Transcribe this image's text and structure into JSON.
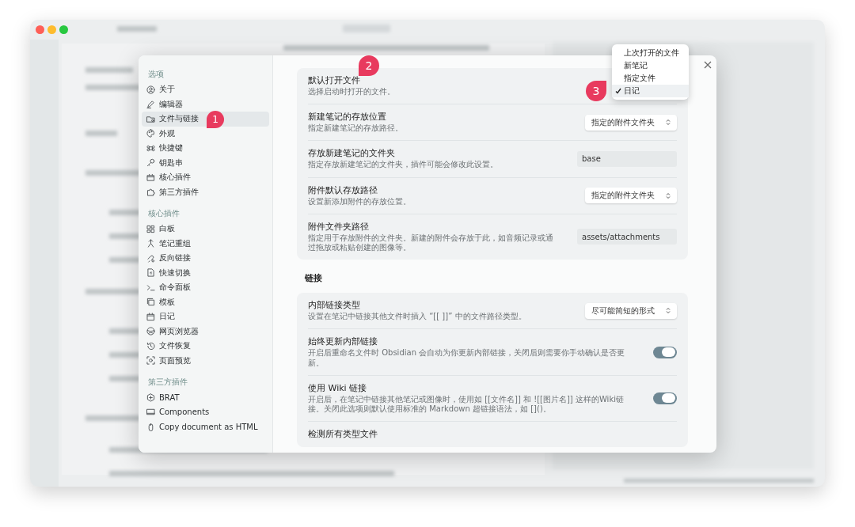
{
  "sidebar": {
    "sections": [
      {
        "heading": "选项",
        "items": [
          {
            "label": "关于",
            "selected": false
          },
          {
            "label": "编辑器",
            "selected": false
          },
          {
            "label": "文件与链接",
            "selected": true,
            "marker": "1"
          },
          {
            "label": "外观",
            "selected": false
          },
          {
            "label": "快捷键",
            "selected": false
          },
          {
            "label": "钥匙串",
            "selected": false
          },
          {
            "label": "核心插件",
            "selected": false
          },
          {
            "label": "第三方插件",
            "selected": false
          }
        ]
      },
      {
        "heading": "核心插件",
        "items": [
          {
            "label": "白板",
            "selected": false
          },
          {
            "label": "笔记重组",
            "selected": false
          },
          {
            "label": "反向链接",
            "selected": false
          },
          {
            "label": "快速切换",
            "selected": false
          },
          {
            "label": "命令面板",
            "selected": false
          },
          {
            "label": "模板",
            "selected": false
          },
          {
            "label": "日记",
            "selected": false
          },
          {
            "label": "网页浏览器",
            "selected": false
          },
          {
            "label": "文件恢复",
            "selected": false
          },
          {
            "label": "页面预览",
            "selected": false
          }
        ]
      },
      {
        "heading": "第三方插件",
        "items": [
          {
            "label": "BRAT",
            "selected": false
          },
          {
            "label": "Components",
            "selected": false
          },
          {
            "label": "Copy document as HTML",
            "selected": false
          }
        ]
      }
    ]
  },
  "settings": {
    "groups": [
      {
        "rows": [
          {
            "kind": "select",
            "title": "默认打开文件",
            "description": "选择启动时打开的文件。",
            "marker": "2",
            "expanded": true,
            "menu_marker": "3",
            "options": [
              {
                "label": "上次打开的文件",
                "selected": false
              },
              {
                "label": "新笔记",
                "selected": false
              },
              {
                "label": "指定文件",
                "selected": false
              },
              {
                "label": "日记",
                "selected": true
              }
            ]
          },
          {
            "kind": "select",
            "title": "新建笔记的存放位置",
            "description": "指定新建笔记的存放路径。",
            "value": "指定的附件文件夹"
          },
          {
            "kind": "text",
            "title": "存放新建笔记的文件夹",
            "description": "指定存放新建笔记的文件夹，插件可能会修改此设置。",
            "value": "base"
          },
          {
            "kind": "select",
            "title": "附件默认存放路径",
            "description": "设置新添加附件的存放位置。",
            "value": "指定的附件文件夹"
          },
          {
            "kind": "text",
            "title": "附件文件夹路径",
            "description": "指定用于存放附件的文件夹。新建的附件会存放于此，如音频记录或通过拖放或粘贴创建的图像等。",
            "value": "assets/attachments"
          }
        ]
      },
      {
        "heading": "链接",
        "rows": [
          {
            "kind": "select",
            "title": "内部链接类型",
            "description": "设置在笔记中链接其他文件时插入 “[[ ]]” 中的文件路径类型。",
            "value": "尽可能简短的形式"
          },
          {
            "kind": "toggle",
            "title": "始终更新内部链接",
            "description": "开启后重命名文件时 Obsidian 会自动为你更新内部链接，关闭后则需要你手动确认是否更新。",
            "on": true
          },
          {
            "kind": "toggle",
            "title": "使用 Wiki 链接",
            "description": "开启后，在笔记中链接其他笔记或图像时，使用如 [[文件名]] 和 ![[图片名]] 这样的Wiki链接。关闭此选项则默认使用标准的 Markdown 超链接语法，如 []()。",
            "on": true
          },
          {
            "kind": "plain",
            "title": "检测所有类型文件"
          }
        ]
      }
    ]
  }
}
